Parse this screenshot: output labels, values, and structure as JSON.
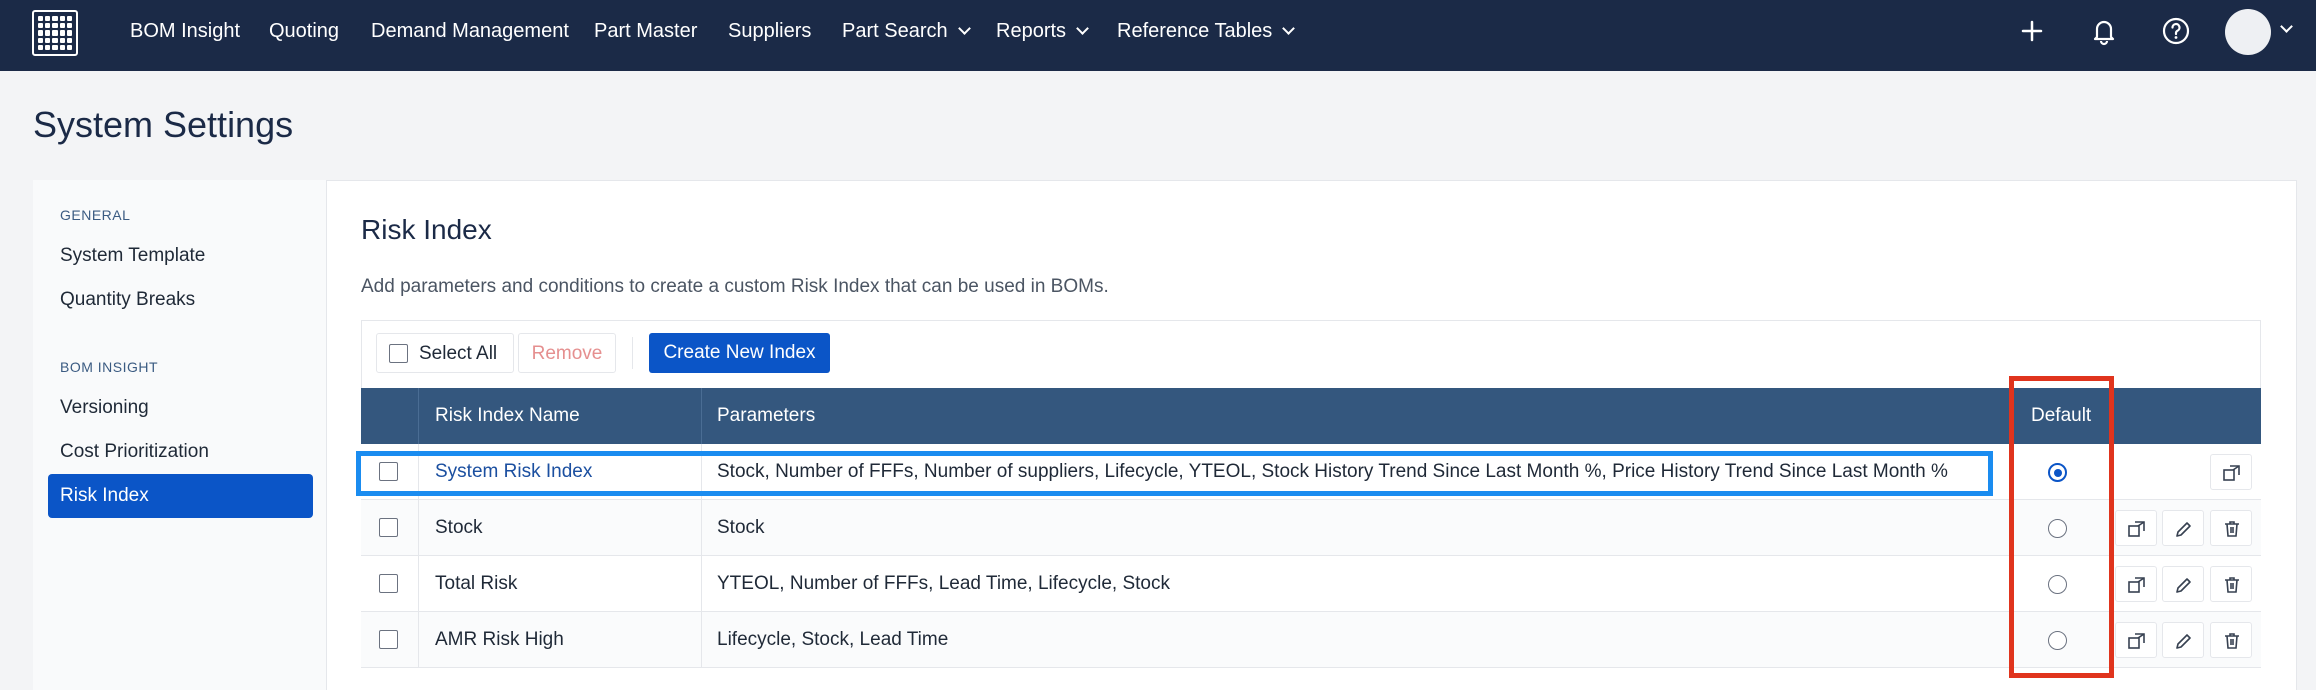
{
  "nav": {
    "items": [
      "BOM Insight",
      "Quoting",
      "Demand Management",
      "Part Master",
      "Suppliers"
    ],
    "dropdowns": [
      "Part Search",
      "Reports",
      "Reference Tables"
    ],
    "icons": [
      "plus-icon",
      "bell-icon",
      "help-icon"
    ]
  },
  "page": {
    "title": "System Settings"
  },
  "sidebar": {
    "general_heading": "GENERAL",
    "general_items": [
      "System Template",
      "Quantity Breaks"
    ],
    "bom_heading": "BOM INSIGHT",
    "bom_items": [
      "Versioning",
      "Cost Prioritization"
    ],
    "active_item": "Risk Index"
  },
  "section": {
    "title": "Risk Index",
    "description": "Add parameters and conditions to create a custom Risk Index that can be used in BOMs."
  },
  "toolbar": {
    "select_all": "Select All",
    "remove": "Remove",
    "create": "Create New Index"
  },
  "table": {
    "columns": {
      "name": "Risk Index Name",
      "parameters": "Parameters",
      "default": "Default"
    },
    "rows": [
      {
        "name": "System Risk Index",
        "parameters": "Stock, Number of FFFs, Number of suppliers, Lifecycle, YTEOL, Stock History Trend Since Last Month %, Price History Trend Since Last Month %",
        "default": true
      },
      {
        "name": "Stock",
        "parameters": "Stock",
        "default": false
      },
      {
        "name": "Total Risk",
        "parameters": "YTEOL, Number of FFFs, Lead Time, Lifecycle, Stock",
        "default": false
      },
      {
        "name": "AMR Risk High",
        "parameters": "Lifecycle, Stock, Lead Time",
        "default": false
      }
    ]
  },
  "colors": {
    "nav_bg": "#1b2a47",
    "primary": "#0b55c7",
    "table_header": "#34577e",
    "highlight_blue": "#1a8cf0",
    "highlight_red": "#e0341d"
  }
}
